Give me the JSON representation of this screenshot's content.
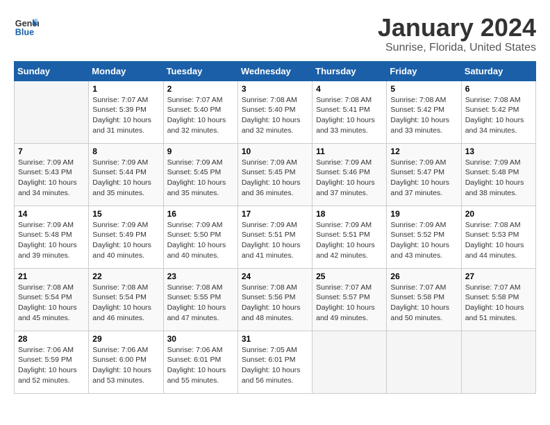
{
  "header": {
    "logo_line1": "General",
    "logo_line2": "Blue",
    "title": "January 2024",
    "subtitle": "Sunrise, Florida, United States"
  },
  "weekdays": [
    "Sunday",
    "Monday",
    "Tuesday",
    "Wednesday",
    "Thursday",
    "Friday",
    "Saturday"
  ],
  "weeks": [
    [
      {
        "day": "",
        "info": ""
      },
      {
        "day": "1",
        "info": "Sunrise: 7:07 AM\nSunset: 5:39 PM\nDaylight: 10 hours\nand 31 minutes."
      },
      {
        "day": "2",
        "info": "Sunrise: 7:07 AM\nSunset: 5:40 PM\nDaylight: 10 hours\nand 32 minutes."
      },
      {
        "day": "3",
        "info": "Sunrise: 7:08 AM\nSunset: 5:40 PM\nDaylight: 10 hours\nand 32 minutes."
      },
      {
        "day": "4",
        "info": "Sunrise: 7:08 AM\nSunset: 5:41 PM\nDaylight: 10 hours\nand 33 minutes."
      },
      {
        "day": "5",
        "info": "Sunrise: 7:08 AM\nSunset: 5:42 PM\nDaylight: 10 hours\nand 33 minutes."
      },
      {
        "day": "6",
        "info": "Sunrise: 7:08 AM\nSunset: 5:42 PM\nDaylight: 10 hours\nand 34 minutes."
      }
    ],
    [
      {
        "day": "7",
        "info": "Sunrise: 7:09 AM\nSunset: 5:43 PM\nDaylight: 10 hours\nand 34 minutes."
      },
      {
        "day": "8",
        "info": "Sunrise: 7:09 AM\nSunset: 5:44 PM\nDaylight: 10 hours\nand 35 minutes."
      },
      {
        "day": "9",
        "info": "Sunrise: 7:09 AM\nSunset: 5:45 PM\nDaylight: 10 hours\nand 35 minutes."
      },
      {
        "day": "10",
        "info": "Sunrise: 7:09 AM\nSunset: 5:45 PM\nDaylight: 10 hours\nand 36 minutes."
      },
      {
        "day": "11",
        "info": "Sunrise: 7:09 AM\nSunset: 5:46 PM\nDaylight: 10 hours\nand 37 minutes."
      },
      {
        "day": "12",
        "info": "Sunrise: 7:09 AM\nSunset: 5:47 PM\nDaylight: 10 hours\nand 37 minutes."
      },
      {
        "day": "13",
        "info": "Sunrise: 7:09 AM\nSunset: 5:48 PM\nDaylight: 10 hours\nand 38 minutes."
      }
    ],
    [
      {
        "day": "14",
        "info": "Sunrise: 7:09 AM\nSunset: 5:48 PM\nDaylight: 10 hours\nand 39 minutes."
      },
      {
        "day": "15",
        "info": "Sunrise: 7:09 AM\nSunset: 5:49 PM\nDaylight: 10 hours\nand 40 minutes."
      },
      {
        "day": "16",
        "info": "Sunrise: 7:09 AM\nSunset: 5:50 PM\nDaylight: 10 hours\nand 40 minutes."
      },
      {
        "day": "17",
        "info": "Sunrise: 7:09 AM\nSunset: 5:51 PM\nDaylight: 10 hours\nand 41 minutes."
      },
      {
        "day": "18",
        "info": "Sunrise: 7:09 AM\nSunset: 5:51 PM\nDaylight: 10 hours\nand 42 minutes."
      },
      {
        "day": "19",
        "info": "Sunrise: 7:09 AM\nSunset: 5:52 PM\nDaylight: 10 hours\nand 43 minutes."
      },
      {
        "day": "20",
        "info": "Sunrise: 7:08 AM\nSunset: 5:53 PM\nDaylight: 10 hours\nand 44 minutes."
      }
    ],
    [
      {
        "day": "21",
        "info": "Sunrise: 7:08 AM\nSunset: 5:54 PM\nDaylight: 10 hours\nand 45 minutes."
      },
      {
        "day": "22",
        "info": "Sunrise: 7:08 AM\nSunset: 5:54 PM\nDaylight: 10 hours\nand 46 minutes."
      },
      {
        "day": "23",
        "info": "Sunrise: 7:08 AM\nSunset: 5:55 PM\nDaylight: 10 hours\nand 47 minutes."
      },
      {
        "day": "24",
        "info": "Sunrise: 7:08 AM\nSunset: 5:56 PM\nDaylight: 10 hours\nand 48 minutes."
      },
      {
        "day": "25",
        "info": "Sunrise: 7:07 AM\nSunset: 5:57 PM\nDaylight: 10 hours\nand 49 minutes."
      },
      {
        "day": "26",
        "info": "Sunrise: 7:07 AM\nSunset: 5:58 PM\nDaylight: 10 hours\nand 50 minutes."
      },
      {
        "day": "27",
        "info": "Sunrise: 7:07 AM\nSunset: 5:58 PM\nDaylight: 10 hours\nand 51 minutes."
      }
    ],
    [
      {
        "day": "28",
        "info": "Sunrise: 7:06 AM\nSunset: 5:59 PM\nDaylight: 10 hours\nand 52 minutes."
      },
      {
        "day": "29",
        "info": "Sunrise: 7:06 AM\nSunset: 6:00 PM\nDaylight: 10 hours\nand 53 minutes."
      },
      {
        "day": "30",
        "info": "Sunrise: 7:06 AM\nSunset: 6:01 PM\nDaylight: 10 hours\nand 55 minutes."
      },
      {
        "day": "31",
        "info": "Sunrise: 7:05 AM\nSunset: 6:01 PM\nDaylight: 10 hours\nand 56 minutes."
      },
      {
        "day": "",
        "info": ""
      },
      {
        "day": "",
        "info": ""
      },
      {
        "day": "",
        "info": ""
      }
    ]
  ]
}
